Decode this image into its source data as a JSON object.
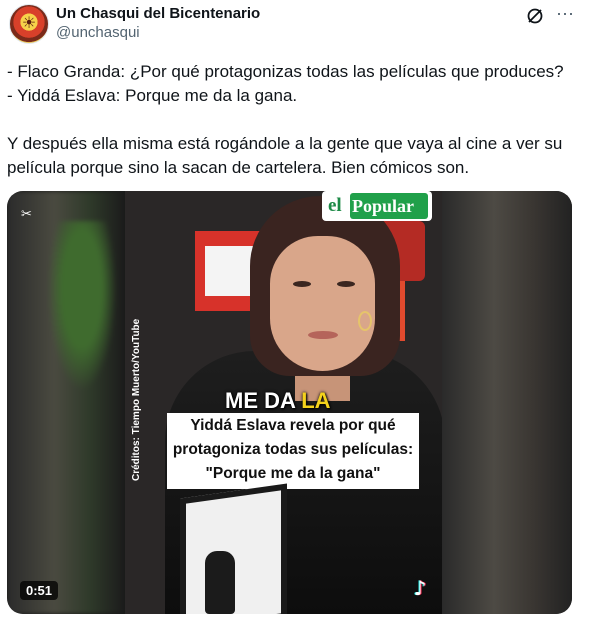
{
  "author": {
    "display_name": "Un Chasqui del Bicentenario",
    "handle": "@unchasqui",
    "avatar_icon": "chasqui-avatar-icon"
  },
  "header_icons": {
    "grok": "grok-icon",
    "more": "⋯"
  },
  "tweet": {
    "text": "- Flaco Granda: ¿Por qué protagonizas todas las películas que produces?\n- Yiddá Eslava: Porque me da la gana.\n\nY después ella misma está rogándole a la gente que vaya al cine a ver su película porque sino la sacan de cartelera. Bien cómicos son."
  },
  "media": {
    "logo_prefix": "el",
    "logo_name": "Popular",
    "credit": "Créditos: Tiempo Muerto/YouTube",
    "caption_top": "ME DA ",
    "caption_top_highlight": "LA",
    "caption_lines": [
      "Yiddá Eslava revela por qué",
      "protagoniza todas sus películas:",
      "\"Porque me da la gana\""
    ],
    "duration": "0:51",
    "colors": {
      "logo_green": "#20a04a",
      "caption_highlight": "#f4d21c"
    }
  }
}
